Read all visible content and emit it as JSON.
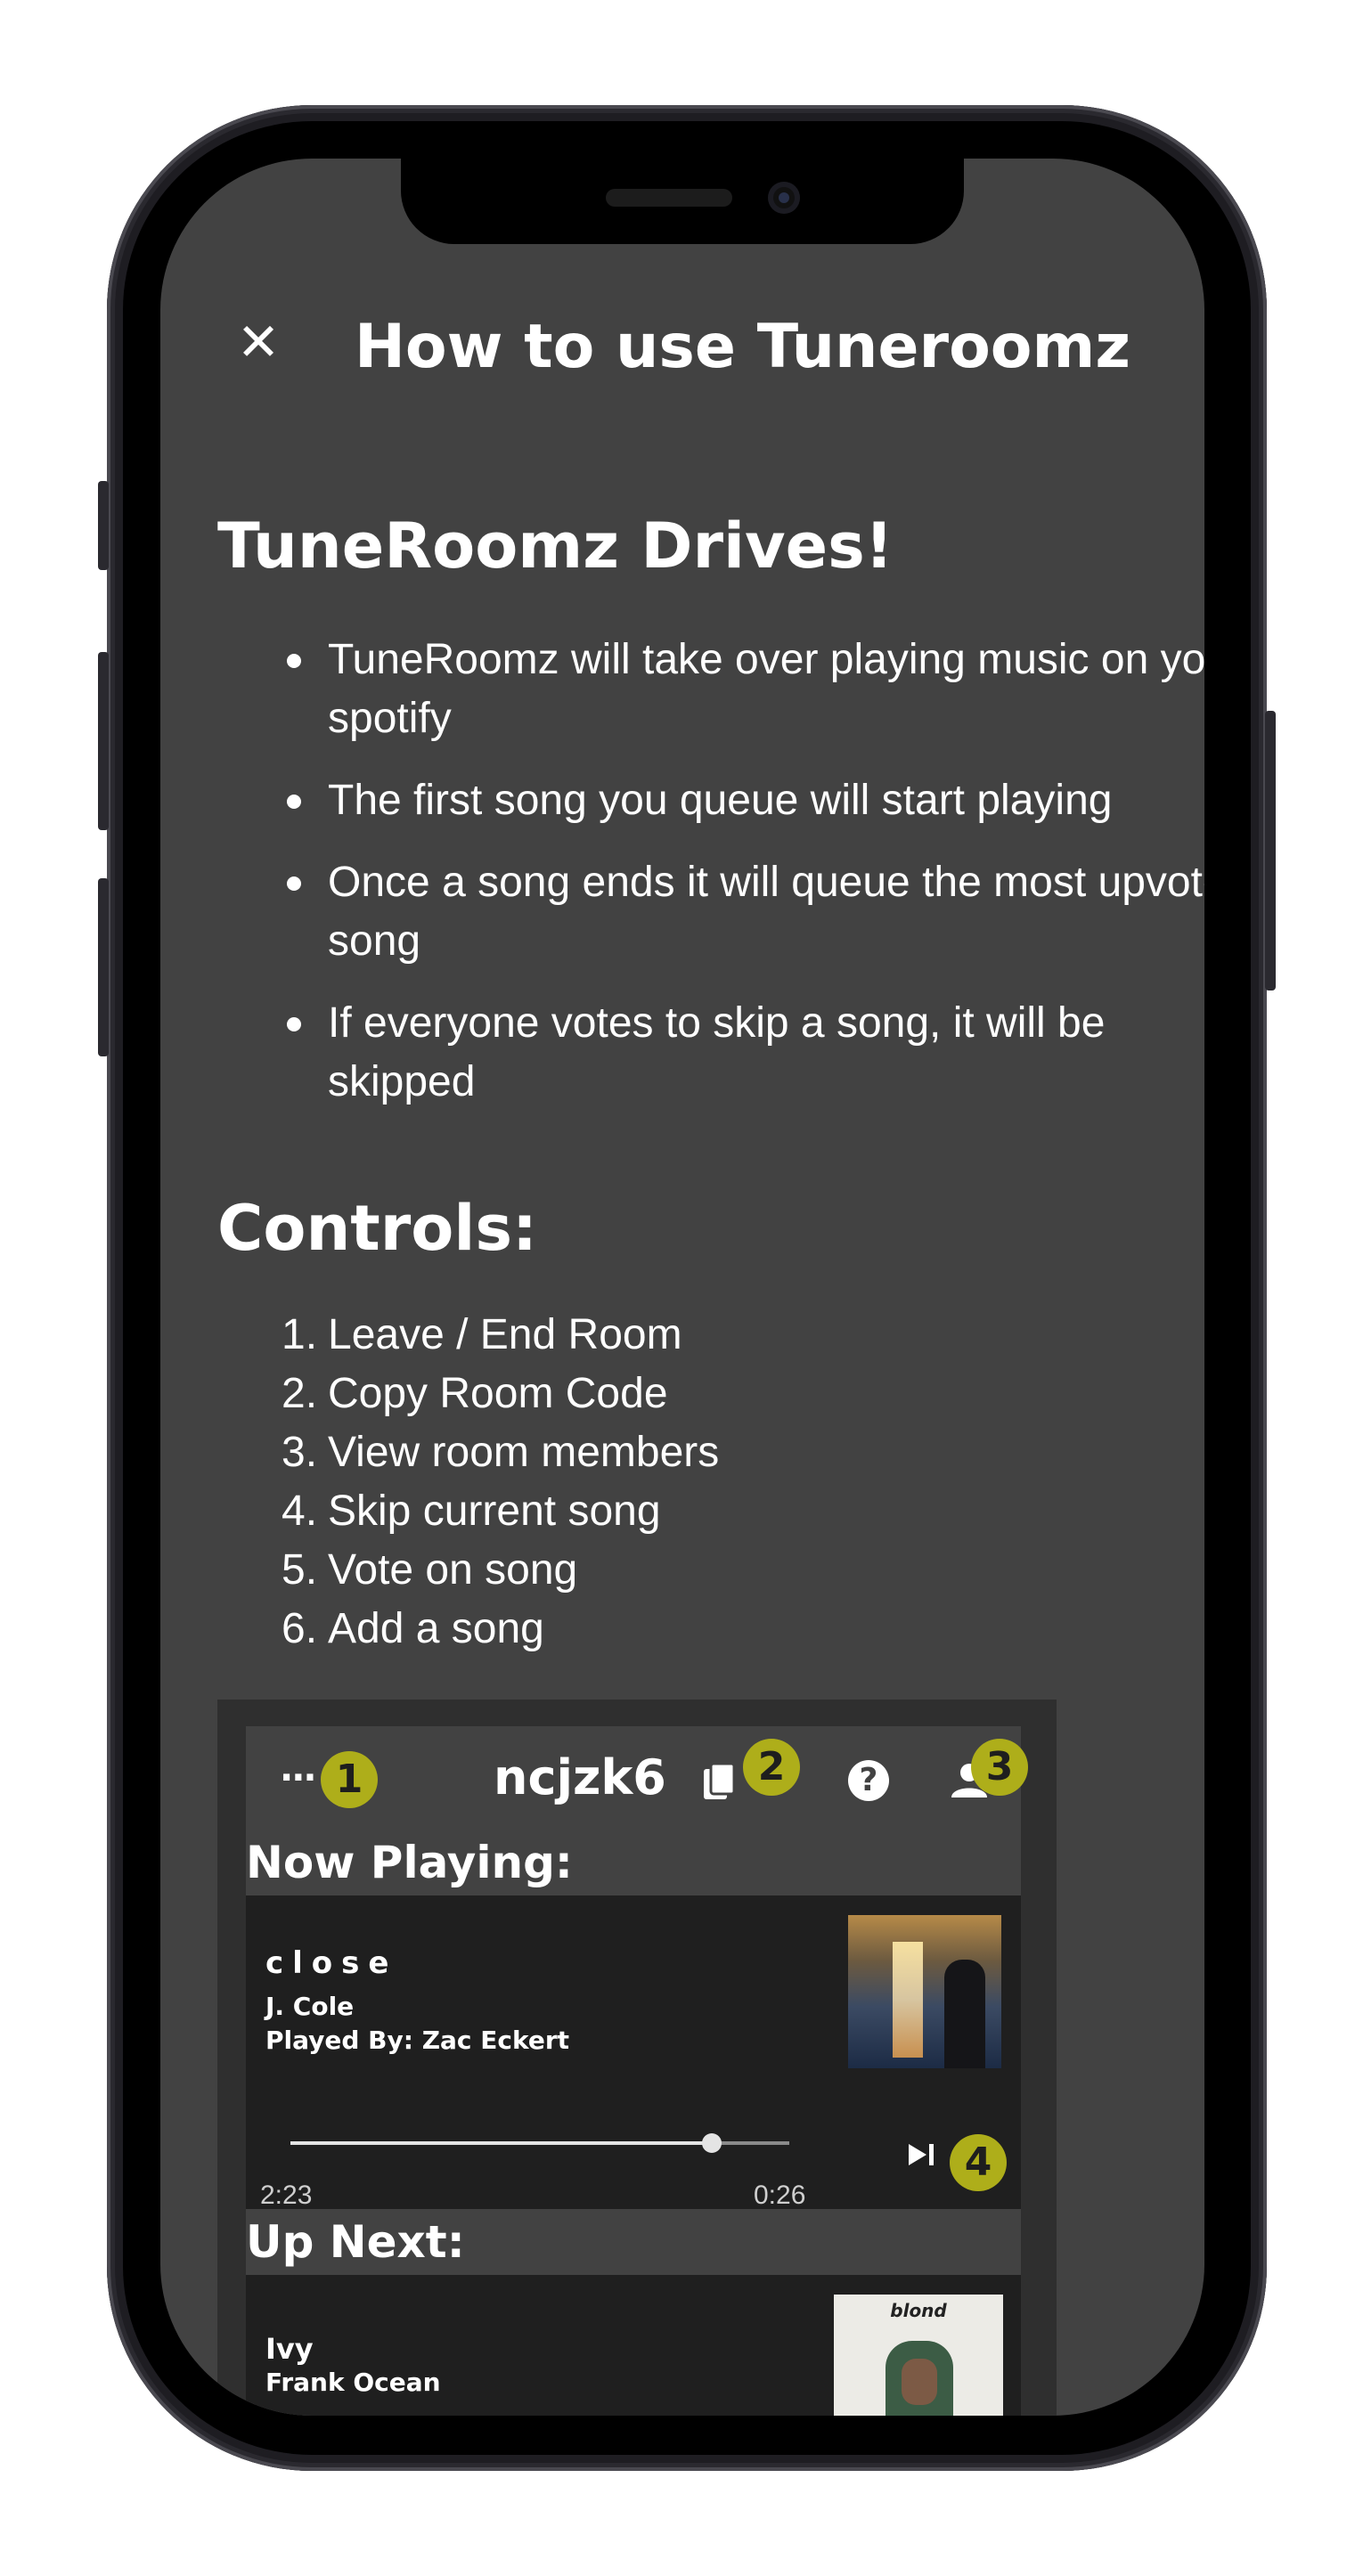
{
  "header": {
    "title": "How to use Tuneroomz",
    "close_symbol": "✕"
  },
  "drives": {
    "heading": "TuneRoomz Drives!",
    "bullets": [
      "TuneRoomz will take over playing music on your spotify",
      "The first song you queue will start playing",
      "Once a song ends it will queue the most upvoted song",
      "If everyone votes to skip a song, it will be skipped"
    ]
  },
  "controls": {
    "heading": "Controls:",
    "items": [
      {
        "num": "1.",
        "label": "Leave / End Room"
      },
      {
        "num": "2.",
        "label": "Copy Room Code"
      },
      {
        "num": "3.",
        "label": "View room members"
      },
      {
        "num": "4.",
        "label": "Skip current song"
      },
      {
        "num": "5.",
        "label": "Vote on song"
      },
      {
        "num": "6.",
        "label": "Add a song"
      }
    ]
  },
  "example": {
    "menu_symbol": "···",
    "room_code": "ncjzk6",
    "help_symbol": "?",
    "badges": [
      "1",
      "2",
      "3",
      "4"
    ],
    "now_playing_label": "Now Playing:",
    "now_playing": {
      "title": "close",
      "artist": "J. Cole",
      "played_by": "Played By: Zac Eckert",
      "elapsed": "2:23",
      "remaining": "0:26",
      "progress_fraction": 0.845
    },
    "up_next_label": "Up Next:",
    "up_next": {
      "title": "Ivy",
      "artist": "Frank Ocean",
      "album_text": "blond"
    }
  },
  "colors": {
    "screen_bg": "#424242",
    "badge": "#aeae1a",
    "card_bg": "#1f1f1f"
  }
}
